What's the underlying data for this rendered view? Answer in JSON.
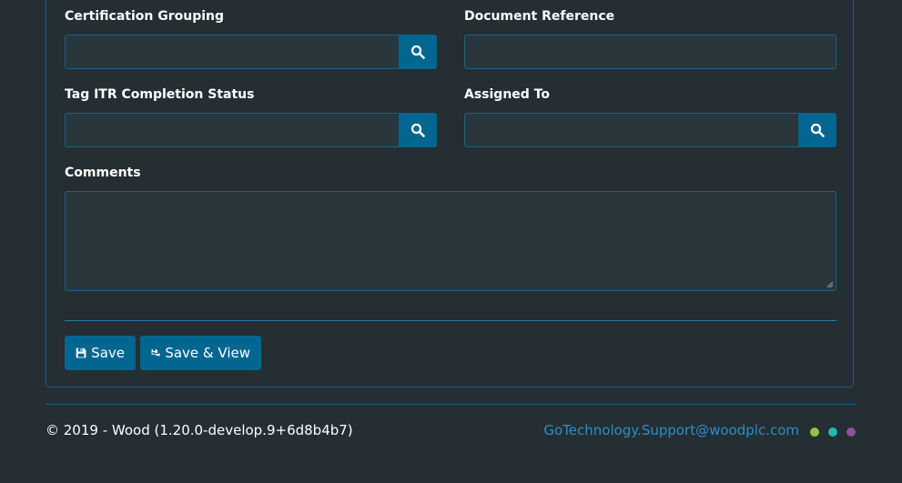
{
  "form": {
    "certification_grouping": {
      "label": "Certification Grouping",
      "value": ""
    },
    "document_reference": {
      "label": "Document Reference",
      "value": ""
    },
    "tag_itr_completion_status": {
      "label": "Tag ITR Completion Status",
      "value": ""
    },
    "assigned_to": {
      "label": "Assigned To",
      "value": ""
    },
    "comments": {
      "label": "Comments",
      "value": ""
    }
  },
  "actions": {
    "save_label": "Save",
    "save_view_label": "Save & View"
  },
  "footer": {
    "copyright": "© 2019 - Wood (1.20.0-develop.9+6d8b4b7)",
    "support_email": "GoTechnology.Support@woodplc.com",
    "dot_colors": [
      "#8dc63f",
      "#22b8b0",
      "#8e4f9c"
    ]
  },
  "colors": {
    "background": "#242e33",
    "accent": "#036690",
    "border": "#1d6282",
    "link": "#2b8fc9"
  }
}
